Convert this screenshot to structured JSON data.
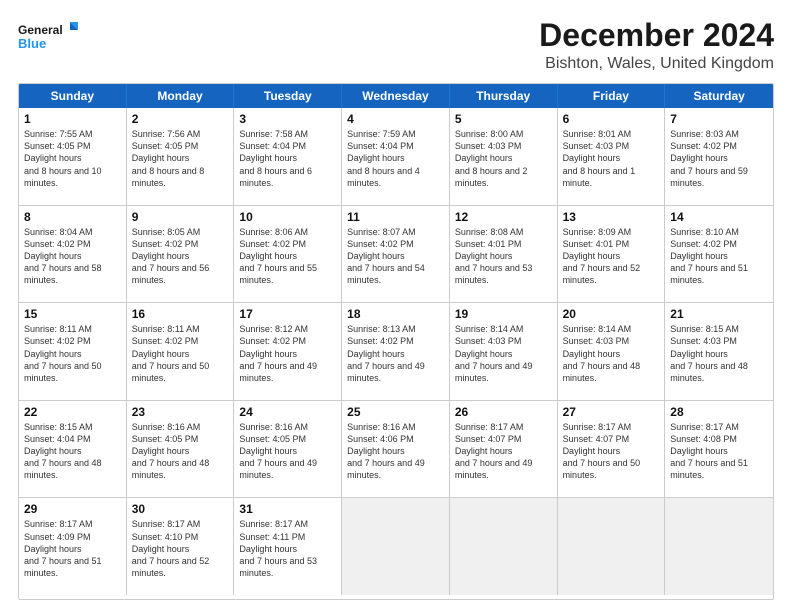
{
  "header": {
    "logo_line1": "General",
    "logo_line2": "Blue",
    "title": "December 2024",
    "subtitle": "Bishton, Wales, United Kingdom"
  },
  "calendar": {
    "days": [
      "Sunday",
      "Monday",
      "Tuesday",
      "Wednesday",
      "Thursday",
      "Friday",
      "Saturday"
    ],
    "rows": [
      [
        {
          "day": "1",
          "sunrise": "7:55 AM",
          "sunset": "4:05 PM",
          "daylight": "8 hours and 10 minutes."
        },
        {
          "day": "2",
          "sunrise": "7:56 AM",
          "sunset": "4:05 PM",
          "daylight": "8 hours and 8 minutes."
        },
        {
          "day": "3",
          "sunrise": "7:58 AM",
          "sunset": "4:04 PM",
          "daylight": "8 hours and 6 minutes."
        },
        {
          "day": "4",
          "sunrise": "7:59 AM",
          "sunset": "4:04 PM",
          "daylight": "8 hours and 4 minutes."
        },
        {
          "day": "5",
          "sunrise": "8:00 AM",
          "sunset": "4:03 PM",
          "daylight": "8 hours and 2 minutes."
        },
        {
          "day": "6",
          "sunrise": "8:01 AM",
          "sunset": "4:03 PM",
          "daylight": "8 hours and 1 minute."
        },
        {
          "day": "7",
          "sunrise": "8:03 AM",
          "sunset": "4:02 PM",
          "daylight": "7 hours and 59 minutes."
        }
      ],
      [
        {
          "day": "8",
          "sunrise": "8:04 AM",
          "sunset": "4:02 PM",
          "daylight": "7 hours and 58 minutes."
        },
        {
          "day": "9",
          "sunrise": "8:05 AM",
          "sunset": "4:02 PM",
          "daylight": "7 hours and 56 minutes."
        },
        {
          "day": "10",
          "sunrise": "8:06 AM",
          "sunset": "4:02 PM",
          "daylight": "7 hours and 55 minutes."
        },
        {
          "day": "11",
          "sunrise": "8:07 AM",
          "sunset": "4:02 PM",
          "daylight": "7 hours and 54 minutes."
        },
        {
          "day": "12",
          "sunrise": "8:08 AM",
          "sunset": "4:01 PM",
          "daylight": "7 hours and 53 minutes."
        },
        {
          "day": "13",
          "sunrise": "8:09 AM",
          "sunset": "4:01 PM",
          "daylight": "7 hours and 52 minutes."
        },
        {
          "day": "14",
          "sunrise": "8:10 AM",
          "sunset": "4:02 PM",
          "daylight": "7 hours and 51 minutes."
        }
      ],
      [
        {
          "day": "15",
          "sunrise": "8:11 AM",
          "sunset": "4:02 PM",
          "daylight": "7 hours and 50 minutes."
        },
        {
          "day": "16",
          "sunrise": "8:11 AM",
          "sunset": "4:02 PM",
          "daylight": "7 hours and 50 minutes."
        },
        {
          "day": "17",
          "sunrise": "8:12 AM",
          "sunset": "4:02 PM",
          "daylight": "7 hours and 49 minutes."
        },
        {
          "day": "18",
          "sunrise": "8:13 AM",
          "sunset": "4:02 PM",
          "daylight": "7 hours and 49 minutes."
        },
        {
          "day": "19",
          "sunrise": "8:14 AM",
          "sunset": "4:03 PM",
          "daylight": "7 hours and 49 minutes."
        },
        {
          "day": "20",
          "sunrise": "8:14 AM",
          "sunset": "4:03 PM",
          "daylight": "7 hours and 48 minutes."
        },
        {
          "day": "21",
          "sunrise": "8:15 AM",
          "sunset": "4:03 PM",
          "daylight": "7 hours and 48 minutes."
        }
      ],
      [
        {
          "day": "22",
          "sunrise": "8:15 AM",
          "sunset": "4:04 PM",
          "daylight": "7 hours and 48 minutes."
        },
        {
          "day": "23",
          "sunrise": "8:16 AM",
          "sunset": "4:05 PM",
          "daylight": "7 hours and 48 minutes."
        },
        {
          "day": "24",
          "sunrise": "8:16 AM",
          "sunset": "4:05 PM",
          "daylight": "7 hours and 49 minutes."
        },
        {
          "day": "25",
          "sunrise": "8:16 AM",
          "sunset": "4:06 PM",
          "daylight": "7 hours and 49 minutes."
        },
        {
          "day": "26",
          "sunrise": "8:17 AM",
          "sunset": "4:07 PM",
          "daylight": "7 hours and 49 minutes."
        },
        {
          "day": "27",
          "sunrise": "8:17 AM",
          "sunset": "4:07 PM",
          "daylight": "7 hours and 50 minutes."
        },
        {
          "day": "28",
          "sunrise": "8:17 AM",
          "sunset": "4:08 PM",
          "daylight": "7 hours and 51 minutes."
        }
      ],
      [
        {
          "day": "29",
          "sunrise": "8:17 AM",
          "sunset": "4:09 PM",
          "daylight": "7 hours and 51 minutes."
        },
        {
          "day": "30",
          "sunrise": "8:17 AM",
          "sunset": "4:10 PM",
          "daylight": "7 hours and 52 minutes."
        },
        {
          "day": "31",
          "sunrise": "8:17 AM",
          "sunset": "4:11 PM",
          "daylight": "7 hours and 53 minutes."
        },
        null,
        null,
        null,
        null
      ]
    ],
    "labels": {
      "sunrise": "Sunrise:",
      "sunset": "Sunset:",
      "daylight": "Daylight:"
    }
  }
}
